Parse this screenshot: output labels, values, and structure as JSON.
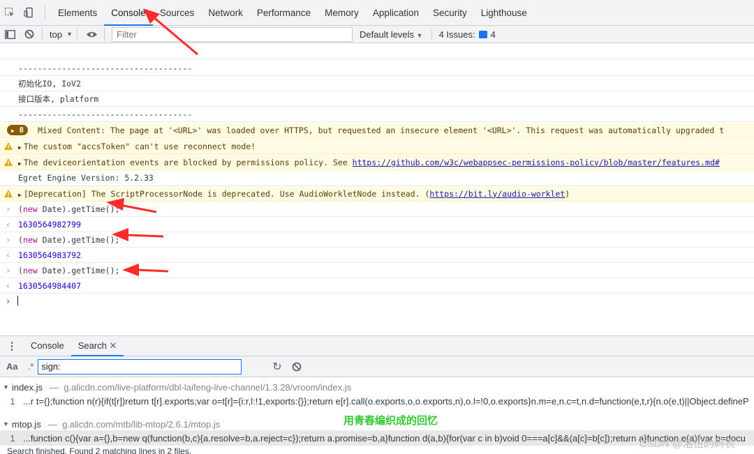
{
  "tabs": [
    "Elements",
    "Console",
    "Sources",
    "Network",
    "Performance",
    "Memory",
    "Application",
    "Security",
    "Lighthouse"
  ],
  "toolbar": {
    "context": "top",
    "filter_placeholder": "Filter",
    "levels": "Default levels",
    "issues_label": "4 Issues:",
    "issues_count": "4"
  },
  "log": [
    {
      "text": "------------------------------------"
    },
    {
      "text": "初始化IO, IoV2"
    },
    {
      "text": "接口版本, platform"
    },
    {
      "text": "------------------------------------"
    },
    {
      "count": "8",
      "text": "Mixed Content: The page at '<URL>' was loaded over HTTPS, but requested an insecure element '<URL>'. This request was automatically upgraded t"
    },
    {
      "text": "The custom \"accsToken\" can't use reconnect mode!"
    },
    {
      "text": "The deviceorientation events are blocked by permissions policy. See ",
      "link": "https://github.com/w3c/webappsec-permissions-policy/blob/master/features.md#"
    },
    {
      "text": "Egret Engine Version: 5.2.33"
    },
    {
      "text": "[Deprecation] The ScriptProcessorNode is deprecated. Use AudioWorkletNode instead. (",
      "link": "https://bit.ly/audio-worklet",
      "tail": ")"
    },
    {
      "kw": "new",
      "text": "Date).getTime();"
    },
    {
      "value": "1630564982799"
    },
    {
      "kw": "new",
      "text": "Date).getTime();"
    },
    {
      "value": "1630564983792"
    },
    {
      "kw": "new",
      "text": "Date).getTime();"
    },
    {
      "value": "1630564984407"
    }
  ],
  "drawer": {
    "tabs": [
      "Console",
      "Search"
    ],
    "search_value": "sign:",
    "case_label": "Aa",
    "regex_label": ".*",
    "results": [
      {
        "file": "index.js",
        "path": "g.alicdn.com/live-platform/dbl-laifeng-live-channel/1.3.28/vroom/index.js",
        "line": "1",
        "snippet": "...r t={};function n(r){if(t[r])return t[r].exports;var o=t[r]={i:r,l:!1,exports:{}};return e[r].call(o.exports,o,o.exports,n),o.l=!0,o.exports}n.m=e,n.c=t,n.d=function(e,t,r){n.o(e,t)||Object.defineP"
      },
      {
        "file": "mtop.js",
        "path": "g.alicdn.com/mtb/lib-mtop/2.6.1/mtop.js",
        "line": "1",
        "snippet": "...function c(){var a={},b=new q(function(b,c){a.resolve=b,a.reject=c});return a.promise=b,a}function d(a,b){for(var c in b)void 0===a[c]&&(a[c]=b[c]);return a}function e(a){var b=docu"
      }
    ],
    "status": "Search finished.  Found 2 matching lines in 2 files."
  },
  "watermark": {
    "middle": "用青春编织成的回忆",
    "corner": "CSDN @洛伍的码农"
  },
  "colors": {
    "accent": "#1a73e8",
    "arrow": "#ff2a2a",
    "watermark_green": "#35c935"
  }
}
